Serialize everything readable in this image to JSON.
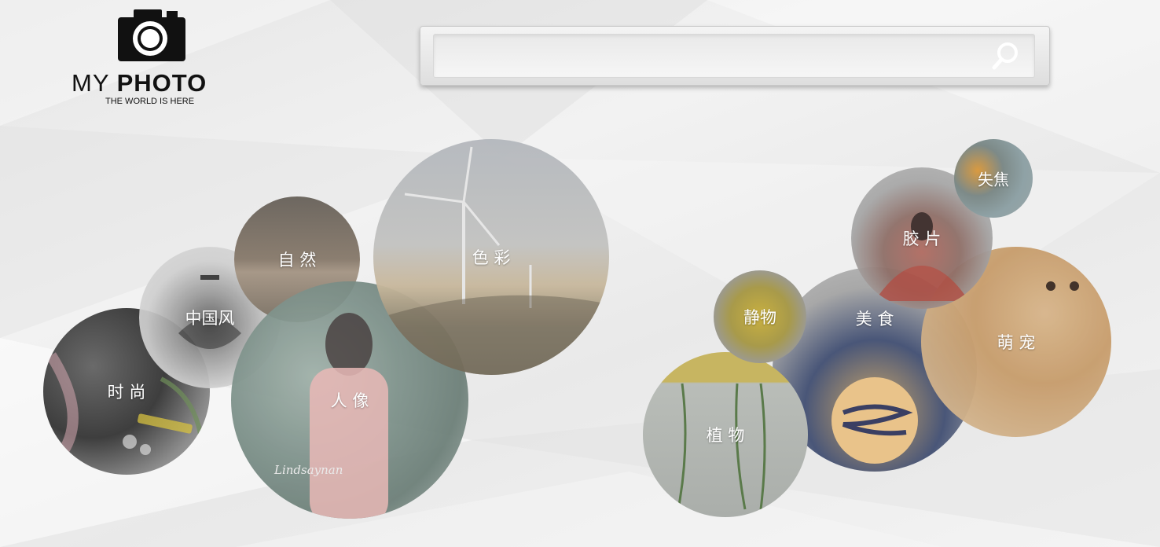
{
  "logo": {
    "brand_light": "MY",
    "brand_bold": "PHOTO",
    "tagline": "THE WORLD IS HERE"
  },
  "search": {
    "placeholder": ""
  },
  "categories": {
    "ziran": "自 然",
    "secai": "色 彩",
    "zhongguofeng": "中国风",
    "shishang": "时 尚",
    "renxiang": "人 像",
    "shijiao": "失焦",
    "jiaopian": "胶 片",
    "jingwu": "静物",
    "mengchong": "萌 宠",
    "meishi": "美 食",
    "zhiwu": "植 物"
  },
  "watermark": "Lindsaynan",
  "colors": {
    "background": "#ececec",
    "logo": "#111111",
    "label": "#ffffff"
  }
}
